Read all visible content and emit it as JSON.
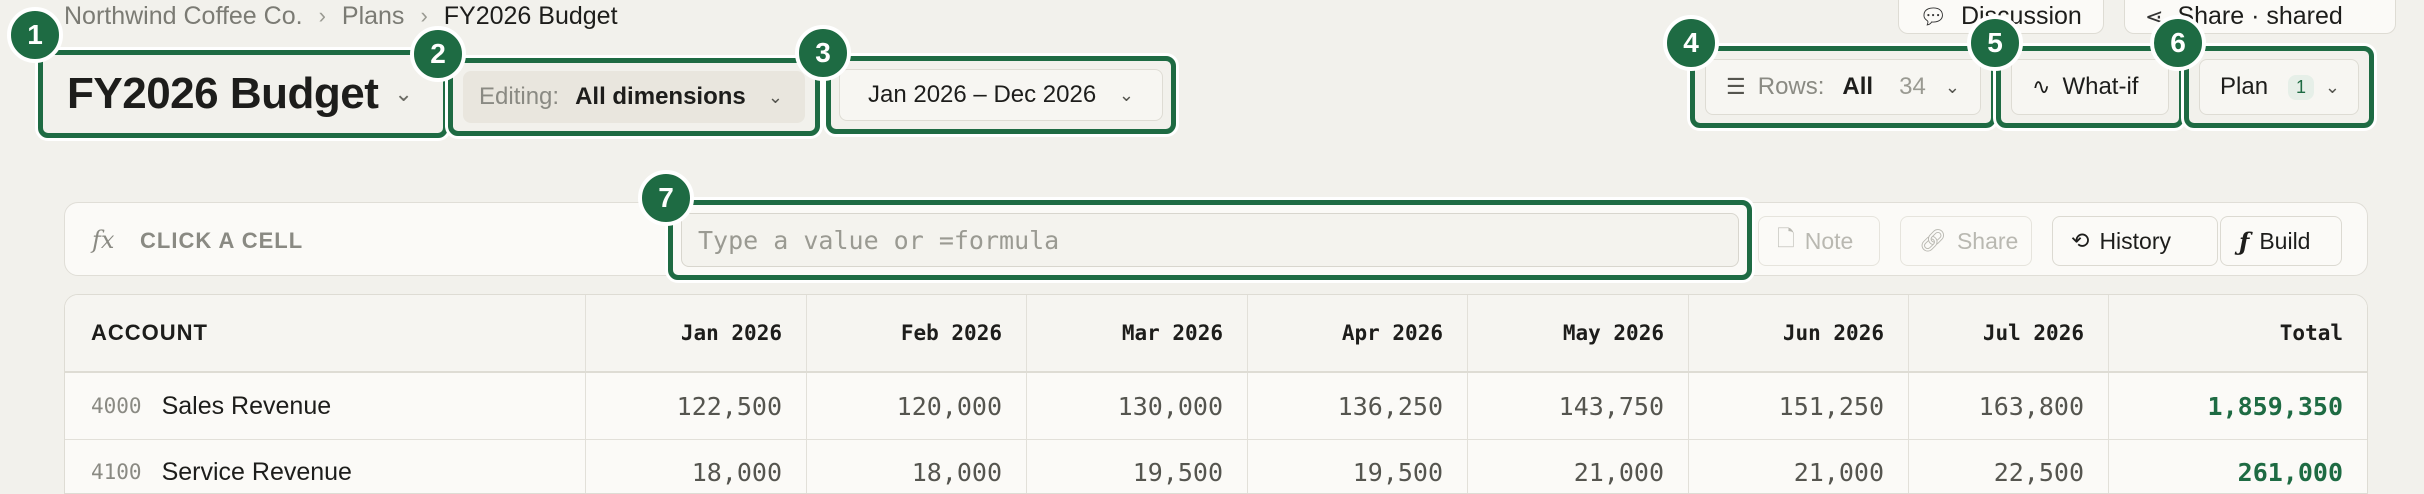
{
  "breadcrumb": {
    "org": "Northwind Coffee Co.",
    "section": "Plans",
    "current": "FY2026 Budget",
    "separator": "›"
  },
  "title": "FY2026 Budget",
  "editing": {
    "label": "Editing:",
    "value": "All dimensions"
  },
  "date_range": "Jan 2026 – Dec 2026",
  "header_buttons": {
    "discussion": "Discussion",
    "share": "Share · shared"
  },
  "rows_filter": {
    "label": "Rows:",
    "value": "All",
    "count": "34"
  },
  "whatif": "What-if",
  "plan": {
    "label": "Plan",
    "badge": "1"
  },
  "markers": [
    "1",
    "2",
    "3",
    "4",
    "5",
    "6",
    "7"
  ],
  "formula_bar": {
    "fx": "fx",
    "cell_ref": "CLICK A CELL",
    "placeholder": "Type a value or =formula",
    "value": "",
    "buttons": {
      "note": "Note",
      "share": "Share",
      "history": "History",
      "build": "Build"
    }
  },
  "table": {
    "headers": [
      "ACCOUNT",
      "Jan 2026",
      "Feb 2026",
      "Mar 2026",
      "Apr 2026",
      "May 2026",
      "Jun 2026",
      "Jul 2026",
      "Total"
    ],
    "rows": [
      {
        "code": "4000",
        "name": "Sales Revenue",
        "values": [
          "122,500",
          "120,000",
          "130,000",
          "136,250",
          "143,750",
          "151,250",
          "163,800"
        ],
        "total": "1,859,350"
      },
      {
        "code": "4100",
        "name": "Service Revenue",
        "values": [
          "18,000",
          "18,000",
          "19,500",
          "19,500",
          "21,000",
          "21,000",
          "22,500"
        ],
        "total": "261,000"
      }
    ]
  },
  "colors": {
    "accent": "#1e6b43",
    "background": "#f2f1ec",
    "total_text": "#1e6b43"
  },
  "icons": {
    "discussion": "speech-bubble-icon",
    "share": "share-nodes-icon",
    "rows": "filter-lines-icon",
    "whatif": "pulse-icon",
    "note": "document-icon",
    "sharebtn": "link-icon",
    "history": "history-clock-icon",
    "build": "function-icon"
  }
}
